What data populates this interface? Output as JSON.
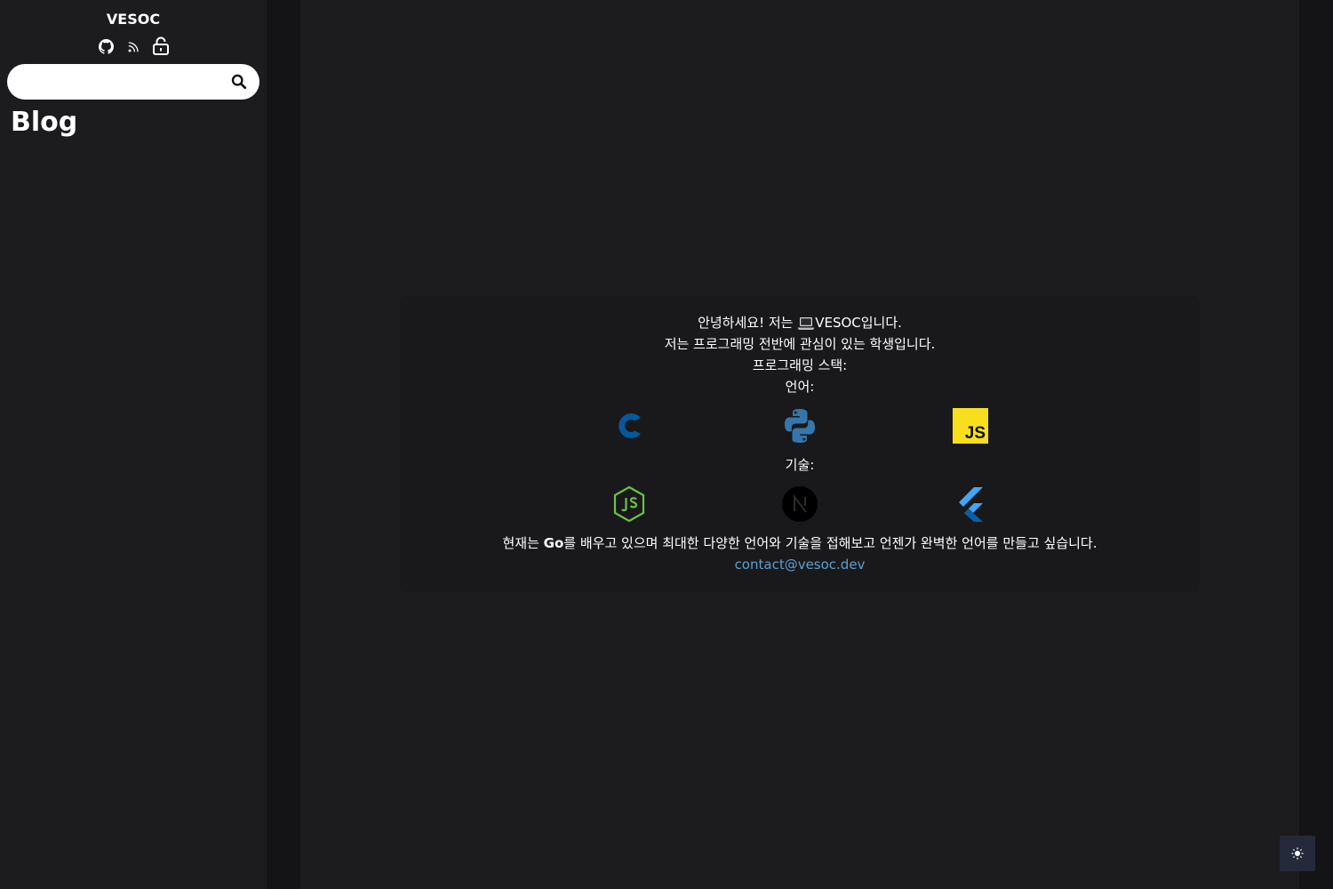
{
  "sidebar": {
    "site_title": "VESOC",
    "icons": [
      "github-icon",
      "rss-icon",
      "unlock-icon"
    ],
    "search": {
      "value": "",
      "placeholder": ""
    },
    "heading": "Blog"
  },
  "intro": {
    "greeting_prefix": "안녕하세요! 저는 ",
    "greeting_emoji": "laptop-emoji",
    "greeting_name": "VESOC입니다.",
    "line2": "저는 프로그래밍 전반에 관심이 있는 학생입니다.",
    "line3": "프로그래밍 스택:",
    "languages_label": "언어:",
    "languages": [
      "c-logo-icon",
      "python-logo-icon",
      "javascript-logo-icon"
    ],
    "js_logo_text": "JS",
    "tech_label": "기술:",
    "tech": [
      "nodejs-logo-icon",
      "nextjs-logo-icon",
      "flutter-logo-icon"
    ],
    "current_prefix": "현재는 ",
    "current_bold": "Go",
    "current_suffix": "를 배우고 있으며 최대한 다양한 언어와 기술을 접해보고 언젠가 완벽한 언어를 만들고 싶습니다.",
    "contact_email": "contact@vesoc.dev"
  },
  "theme_toggle": {
    "icon": "sun-icon"
  },
  "colors": {
    "background": "#1c1c1e",
    "gutter": "#141416",
    "card": "#19191b",
    "link": "#5e9fd0",
    "c_blue": "#03599c",
    "python_blue": "#3776ab",
    "js_yellow": "#f7df1e",
    "node_green": "#6cc24a",
    "flutter_blue": "#42a5f5"
  }
}
